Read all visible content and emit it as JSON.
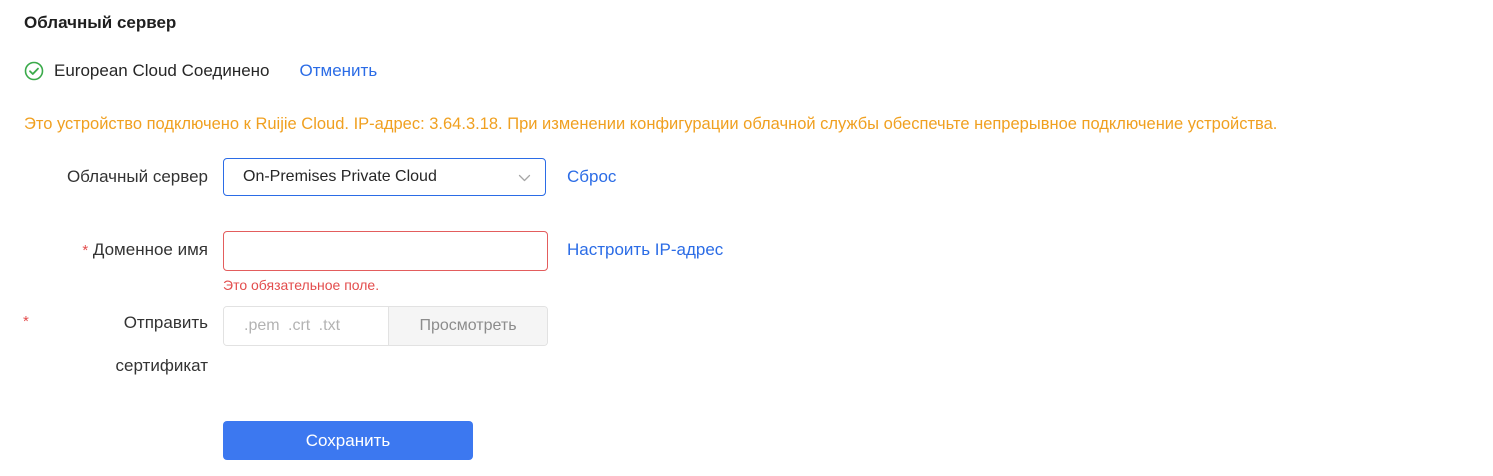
{
  "section": {
    "title": "Облачный сервер"
  },
  "status": {
    "icon": "check-circle-icon",
    "icon_color": "#3aaa4a",
    "text": "European Cloud Соединено",
    "cancel_label": "Отменить"
  },
  "notice": {
    "text": "Это устройство подключено к Ruijie Cloud. IP-адрес: 3.64.3.18. При изменении конфигурации облачной службы обеспечьте непрерывное подключение устройства.",
    "color": "#f0a020"
  },
  "form": {
    "cloud_server": {
      "label": "Облачный сервер",
      "selected": "On-Premises Private Cloud",
      "reset_label": "Сброс"
    },
    "domain": {
      "required_mark": "*",
      "label": "Доменное имя",
      "value": "",
      "configure_ip_label": "Настроить IP-адрес",
      "error": "Это обязательное поле."
    },
    "certificate": {
      "required_mark": "*",
      "label_line1": "Отправить",
      "label_line2": "сертификат",
      "placeholder": ".pem .crt .txt",
      "browse_label": "Просмотреть"
    },
    "save_label": "Сохранить"
  },
  "colors": {
    "accent": "#2b6ce6",
    "primary_button": "#3c78f0",
    "error": "#e34d4d"
  }
}
